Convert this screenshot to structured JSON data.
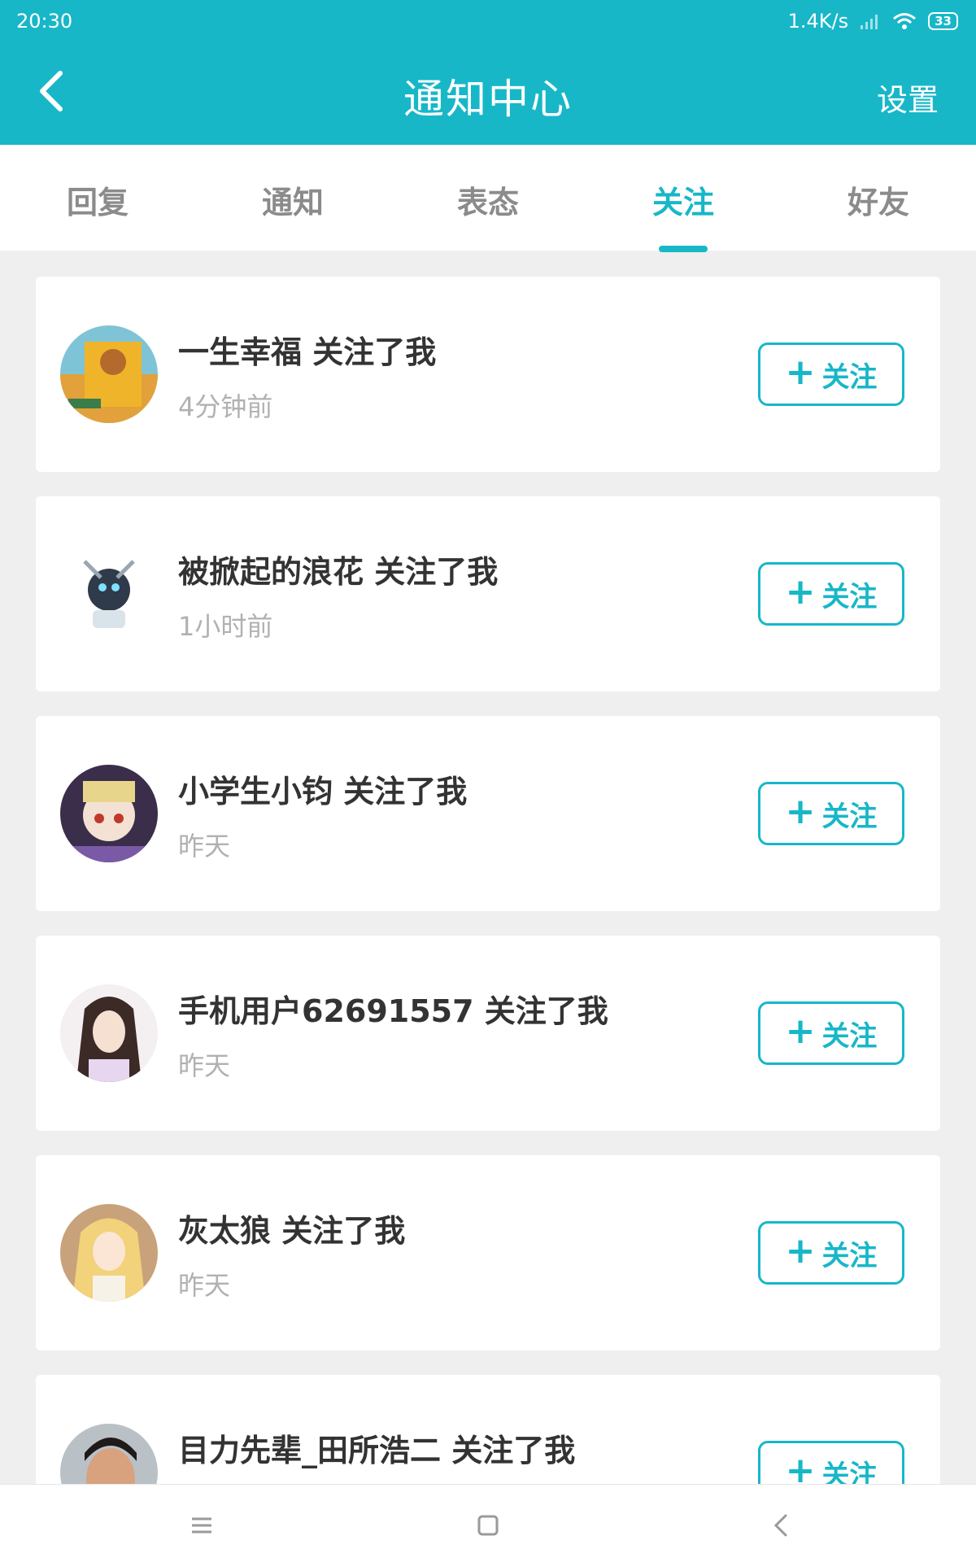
{
  "status_bar": {
    "time": "20:30",
    "speed": "1.4K/s",
    "battery": "33"
  },
  "header": {
    "title": "通知中心",
    "settings_label": "设置"
  },
  "tabs": [
    {
      "label": "回复",
      "active": false
    },
    {
      "label": "通知",
      "active": false
    },
    {
      "label": "表态",
      "active": false
    },
    {
      "label": "关注",
      "active": true
    },
    {
      "label": "好友",
      "active": false
    }
  ],
  "notifications": [
    {
      "name": "一生幸福 关注了我",
      "time": "4分钟前",
      "button": "关注",
      "avatar": "game-avatar"
    },
    {
      "name": "被掀起的浪花 关注了我",
      "time": "1小时前",
      "button": "关注",
      "avatar": "robot-avatar"
    },
    {
      "name": "小学生小钧 关注了我",
      "time": "昨天",
      "button": "关注",
      "avatar": "anime-girl-avatar"
    },
    {
      "name": "手机用户62691557 关注了我",
      "time": "昨天",
      "button": "关注",
      "avatar": "dark-hair-girl-avatar"
    },
    {
      "name": "灰太狼 关注了我",
      "time": "昨天",
      "button": "关注",
      "avatar": "blonde-girl-avatar"
    },
    {
      "name": "目力先辈_田所浩二 关注了我",
      "time": "",
      "button": "关注",
      "avatar": "man-avatar"
    }
  ],
  "colors": {
    "accent": "#17b7c8",
    "background": "#efefef",
    "inactive_tab": "#8b8b8b"
  }
}
